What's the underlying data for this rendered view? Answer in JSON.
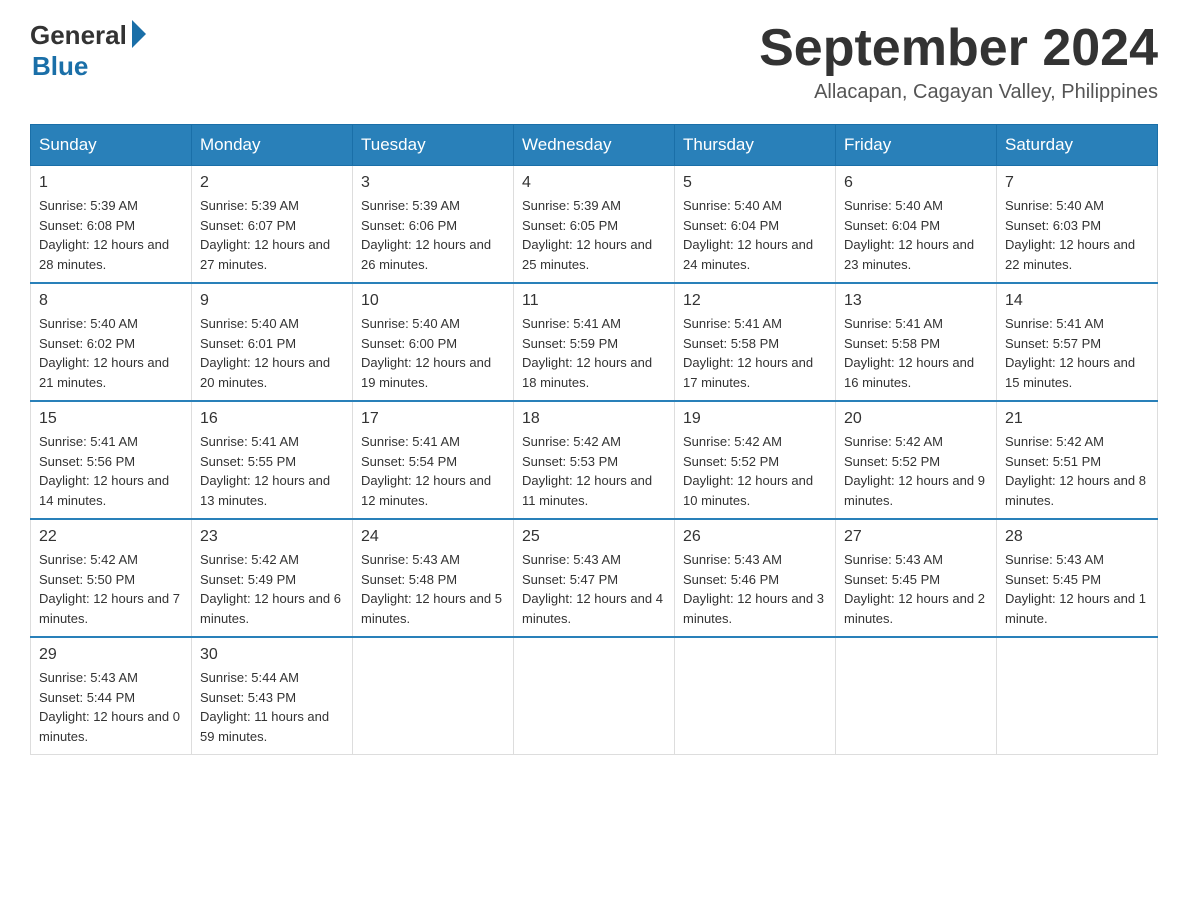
{
  "header": {
    "logo_general": "General",
    "logo_blue": "Blue",
    "month_title": "September 2024",
    "location": "Allacapan, Cagayan Valley, Philippines"
  },
  "calendar": {
    "days_of_week": [
      "Sunday",
      "Monday",
      "Tuesday",
      "Wednesday",
      "Thursday",
      "Friday",
      "Saturday"
    ],
    "weeks": [
      [
        {
          "day": "1",
          "sunrise": "5:39 AM",
          "sunset": "6:08 PM",
          "daylight": "12 hours and 28 minutes."
        },
        {
          "day": "2",
          "sunrise": "5:39 AM",
          "sunset": "6:07 PM",
          "daylight": "12 hours and 27 minutes."
        },
        {
          "day": "3",
          "sunrise": "5:39 AM",
          "sunset": "6:06 PM",
          "daylight": "12 hours and 26 minutes."
        },
        {
          "day": "4",
          "sunrise": "5:39 AM",
          "sunset": "6:05 PM",
          "daylight": "12 hours and 25 minutes."
        },
        {
          "day": "5",
          "sunrise": "5:40 AM",
          "sunset": "6:04 PM",
          "daylight": "12 hours and 24 minutes."
        },
        {
          "day": "6",
          "sunrise": "5:40 AM",
          "sunset": "6:04 PM",
          "daylight": "12 hours and 23 minutes."
        },
        {
          "day": "7",
          "sunrise": "5:40 AM",
          "sunset": "6:03 PM",
          "daylight": "12 hours and 22 minutes."
        }
      ],
      [
        {
          "day": "8",
          "sunrise": "5:40 AM",
          "sunset": "6:02 PM",
          "daylight": "12 hours and 21 minutes."
        },
        {
          "day": "9",
          "sunrise": "5:40 AM",
          "sunset": "6:01 PM",
          "daylight": "12 hours and 20 minutes."
        },
        {
          "day": "10",
          "sunrise": "5:40 AM",
          "sunset": "6:00 PM",
          "daylight": "12 hours and 19 minutes."
        },
        {
          "day": "11",
          "sunrise": "5:41 AM",
          "sunset": "5:59 PM",
          "daylight": "12 hours and 18 minutes."
        },
        {
          "day": "12",
          "sunrise": "5:41 AM",
          "sunset": "5:58 PM",
          "daylight": "12 hours and 17 minutes."
        },
        {
          "day": "13",
          "sunrise": "5:41 AM",
          "sunset": "5:58 PM",
          "daylight": "12 hours and 16 minutes."
        },
        {
          "day": "14",
          "sunrise": "5:41 AM",
          "sunset": "5:57 PM",
          "daylight": "12 hours and 15 minutes."
        }
      ],
      [
        {
          "day": "15",
          "sunrise": "5:41 AM",
          "sunset": "5:56 PM",
          "daylight": "12 hours and 14 minutes."
        },
        {
          "day": "16",
          "sunrise": "5:41 AM",
          "sunset": "5:55 PM",
          "daylight": "12 hours and 13 minutes."
        },
        {
          "day": "17",
          "sunrise": "5:41 AM",
          "sunset": "5:54 PM",
          "daylight": "12 hours and 12 minutes."
        },
        {
          "day": "18",
          "sunrise": "5:42 AM",
          "sunset": "5:53 PM",
          "daylight": "12 hours and 11 minutes."
        },
        {
          "day": "19",
          "sunrise": "5:42 AM",
          "sunset": "5:52 PM",
          "daylight": "12 hours and 10 minutes."
        },
        {
          "day": "20",
          "sunrise": "5:42 AM",
          "sunset": "5:52 PM",
          "daylight": "12 hours and 9 minutes."
        },
        {
          "day": "21",
          "sunrise": "5:42 AM",
          "sunset": "5:51 PM",
          "daylight": "12 hours and 8 minutes."
        }
      ],
      [
        {
          "day": "22",
          "sunrise": "5:42 AM",
          "sunset": "5:50 PM",
          "daylight": "12 hours and 7 minutes."
        },
        {
          "day": "23",
          "sunrise": "5:42 AM",
          "sunset": "5:49 PM",
          "daylight": "12 hours and 6 minutes."
        },
        {
          "day": "24",
          "sunrise": "5:43 AM",
          "sunset": "5:48 PM",
          "daylight": "12 hours and 5 minutes."
        },
        {
          "day": "25",
          "sunrise": "5:43 AM",
          "sunset": "5:47 PM",
          "daylight": "12 hours and 4 minutes."
        },
        {
          "day": "26",
          "sunrise": "5:43 AM",
          "sunset": "5:46 PM",
          "daylight": "12 hours and 3 minutes."
        },
        {
          "day": "27",
          "sunrise": "5:43 AM",
          "sunset": "5:45 PM",
          "daylight": "12 hours and 2 minutes."
        },
        {
          "day": "28",
          "sunrise": "5:43 AM",
          "sunset": "5:45 PM",
          "daylight": "12 hours and 1 minute."
        }
      ],
      [
        {
          "day": "29",
          "sunrise": "5:43 AM",
          "sunset": "5:44 PM",
          "daylight": "12 hours and 0 minutes."
        },
        {
          "day": "30",
          "sunrise": "5:44 AM",
          "sunset": "5:43 PM",
          "daylight": "11 hours and 59 minutes."
        },
        null,
        null,
        null,
        null,
        null
      ]
    ],
    "labels": {
      "sunrise": "Sunrise:",
      "sunset": "Sunset:",
      "daylight": "Daylight:"
    }
  }
}
